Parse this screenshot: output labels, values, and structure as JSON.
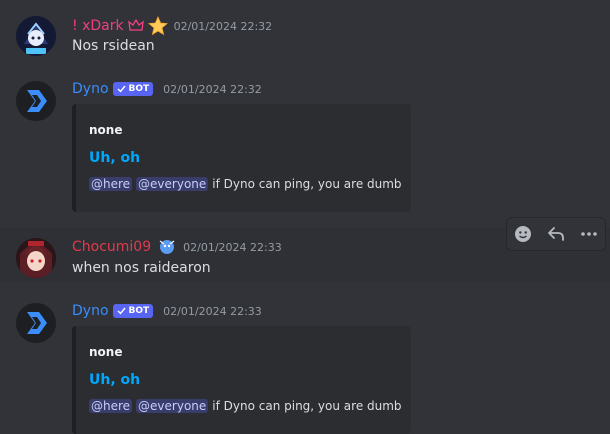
{
  "messages": [
    {
      "username": "! xDark",
      "name_color": "#f23f7f",
      "timestamp": "02/01/2024 22:32",
      "content": "Nos rsidean",
      "icons": [
        "crown-icon",
        "star-icon"
      ]
    },
    {
      "username": "Dyno",
      "name_color": "#3b8dfb",
      "tag": "BOT",
      "timestamp": "02/01/2024 22:32",
      "embed": {
        "author": "none",
        "title": "Uh, oh",
        "mention_here": "@here",
        "mention_everyone": "@everyone",
        "text": "if Dyno can ping, you are dumb"
      }
    },
    {
      "username": "Chocumi09",
      "name_color": "#e23a4a",
      "timestamp": "02/01/2024 22:33",
      "content": "when nos raidearon",
      "icons": [
        "character-badge-icon"
      ]
    },
    {
      "username": "Dyno",
      "name_color": "#3b8dfb",
      "tag": "BOT",
      "timestamp": "02/01/2024 22:33",
      "embed": {
        "author": "none",
        "title": "Uh, oh",
        "mention_here": "@here",
        "mention_everyone": "@everyone",
        "text": "if Dyno can ping, you are dumb"
      }
    }
  ],
  "toolbar": {
    "actions": [
      "add-reaction-icon",
      "reply-icon",
      "more-icon"
    ]
  }
}
